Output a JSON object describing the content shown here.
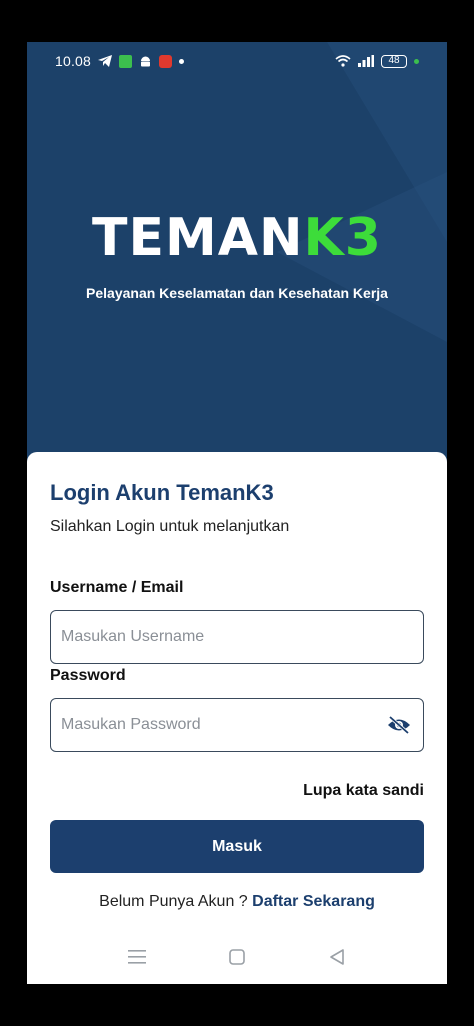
{
  "status_bar": {
    "time": "10.08",
    "battery": "48"
  },
  "brand": {
    "logo_main": "TEMAN",
    "logo_accent": "K3",
    "tagline": "Pelayanan Keselamatan dan Kesehatan Kerja"
  },
  "login": {
    "title": "Login Akun TemanK3",
    "subtitle": "Silahkan Login untuk melanjutkan",
    "username_label": "Username / Email",
    "username_placeholder": "Masukan Username",
    "password_label": "Password",
    "password_placeholder": "Masukan Password",
    "forgot_label": "Lupa kata sandi",
    "submit_label": "Masuk",
    "register_prompt": "Belum Punya Akun ?",
    "register_link": "Daftar Sekarang"
  },
  "icons": {
    "status": [
      "telegram-icon",
      "app-notification-icon",
      "android-icon",
      "shield-app-icon",
      "wifi-icon",
      "signal-icon",
      "battery-icon"
    ],
    "password_toggle": "eye-slash-icon",
    "nav": [
      "menu-icon",
      "home-icon",
      "back-icon"
    ]
  },
  "colors": {
    "primary": "#1c3f6e",
    "hero_bg": "#1c4169",
    "accent": "#3ddc3a"
  }
}
